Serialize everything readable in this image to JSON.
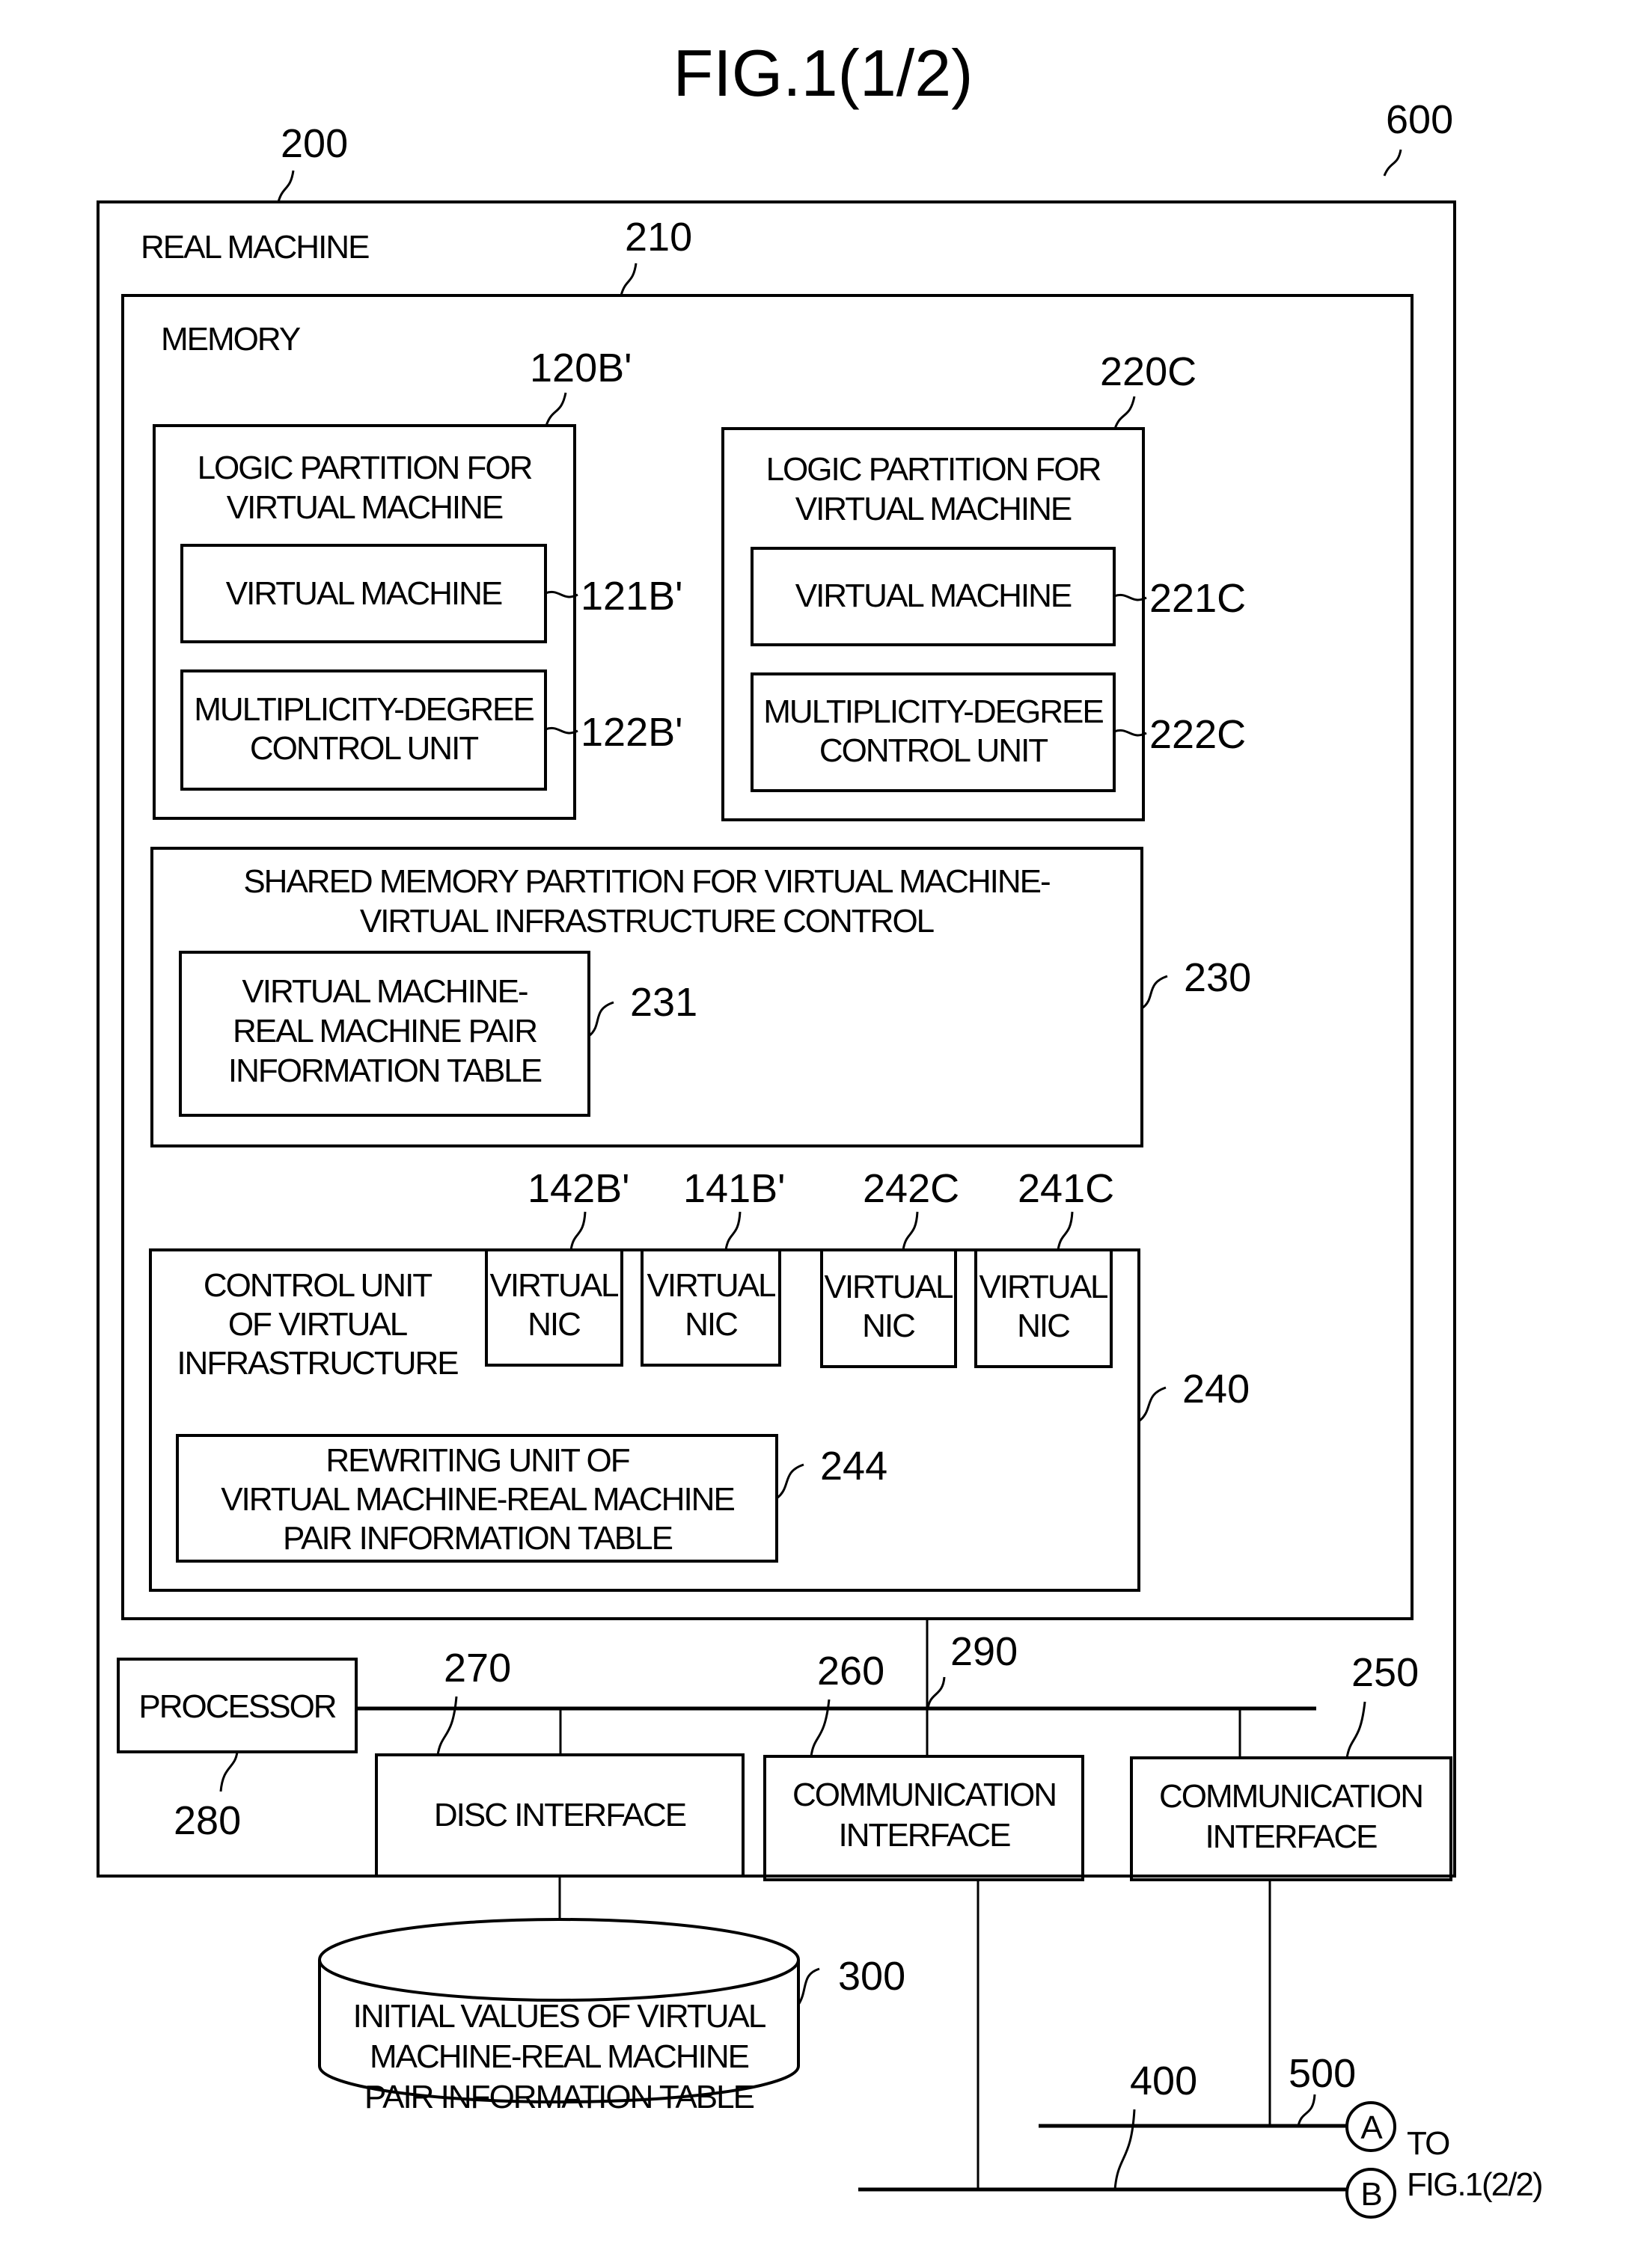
{
  "figure": {
    "title": "FIG.1(1/2)",
    "continuation": {
      "to_label": "TO",
      "target": "FIG.1(2/2)",
      "connector_a": "A",
      "connector_b": "B"
    }
  },
  "real_machine": {
    "ref": "200",
    "system_ref": "600",
    "label": "REAL MACHINE"
  },
  "memory": {
    "ref": "210",
    "label": "MEMORY",
    "partitions": [
      {
        "ref": "120B'",
        "title_lines": [
          "LOGIC PARTITION FOR",
          "VIRTUAL MACHINE"
        ],
        "virtual_machine": {
          "ref": "121B'",
          "label": "VIRTUAL MACHINE"
        },
        "mdc_unit": {
          "ref": "122B'",
          "lines": [
            "MULTIPLICITY-DEGREE",
            "CONTROL UNIT"
          ]
        }
      },
      {
        "ref": "220C",
        "title_lines": [
          "LOGIC PARTITION FOR",
          "VIRTUAL MACHINE"
        ],
        "virtual_machine": {
          "ref": "221C",
          "label": "VIRTUAL MACHINE"
        },
        "mdc_unit": {
          "ref": "222C",
          "lines": [
            "MULTIPLICITY-DEGREE",
            "CONTROL UNIT"
          ]
        }
      }
    ],
    "shared": {
      "ref": "230",
      "title_lines": [
        "SHARED MEMORY PARTITION FOR VIRTUAL MACHINE-",
        "VIRTUAL INFRASTRUCTURE CONTROL"
      ],
      "table": {
        "ref": "231",
        "lines": [
          "VIRTUAL MACHINE-",
          "REAL MACHINE PAIR",
          "INFORMATION TABLE"
        ]
      }
    },
    "control_unit": {
      "ref": "240",
      "title_lines": [
        "CONTROL UNIT",
        "OF VIRTUAL",
        "INFRASTRUCTURE"
      ],
      "nics": [
        {
          "ref": "142B'",
          "lines": [
            "VIRTUAL",
            "NIC"
          ]
        },
        {
          "ref": "141B'",
          "lines": [
            "VIRTUAL",
            "NIC"
          ]
        },
        {
          "ref": "242C",
          "lines": [
            "VIRTUAL",
            "NIC"
          ]
        },
        {
          "ref": "241C",
          "lines": [
            "VIRTUAL",
            "NIC"
          ]
        }
      ],
      "rewriting_unit": {
        "ref": "244",
        "lines": [
          "REWRITING UNIT OF",
          "VIRTUAL MACHINE-REAL MACHINE",
          "PAIR INFORMATION TABLE"
        ]
      }
    }
  },
  "hardware": {
    "processor": {
      "ref": "280",
      "label": "PROCESSOR"
    },
    "bus": {
      "ref": "290"
    },
    "disc_interface": {
      "ref": "270",
      "label": "DISC INTERFACE"
    },
    "comm_interface_1": {
      "ref": "260",
      "lines": [
        "COMMUNICATION",
        "INTERFACE"
      ]
    },
    "comm_interface_2": {
      "ref": "250",
      "lines": [
        "COMMUNICATION",
        "INTERFACE"
      ]
    }
  },
  "storage": {
    "ref": "300",
    "lines": [
      "INITIAL VALUES OF VIRTUAL",
      "MACHINE-REAL MACHINE",
      "PAIR INFORMATION TABLE"
    ]
  },
  "networks": {
    "net_400": {
      "ref": "400"
    },
    "net_500": {
      "ref": "500"
    }
  }
}
